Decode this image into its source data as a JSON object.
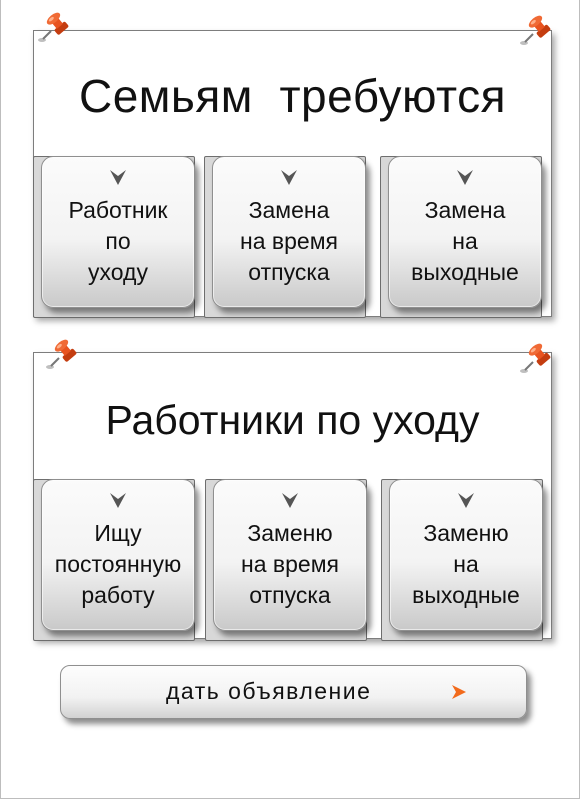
{
  "section_family": {
    "title": "Семьям  требуются",
    "cards": [
      {
        "label": "Работник\nпо\nуходу"
      },
      {
        "label": "Замена\nна время\nотпуска"
      },
      {
        "label": "Замена\nна\nвыходные"
      }
    ]
  },
  "section_workers": {
    "title": "Работники по уходу",
    "cards": [
      {
        "label": "Ищу\nпостоянную\nработу"
      },
      {
        "label": "Заменю\nна время\nотпуска"
      },
      {
        "label": "Заменю\nна\nвыходные"
      }
    ]
  },
  "action": {
    "label": "дать объявление"
  },
  "colors": {
    "pin": "#e8531f",
    "arrow_accent": "#f26a1b",
    "card_arrow": "#555555"
  },
  "icons": {
    "pin": "push-pin-icon",
    "card_arrow": "chevron-down-icon",
    "action_arrow": "arrow-right-icon"
  }
}
